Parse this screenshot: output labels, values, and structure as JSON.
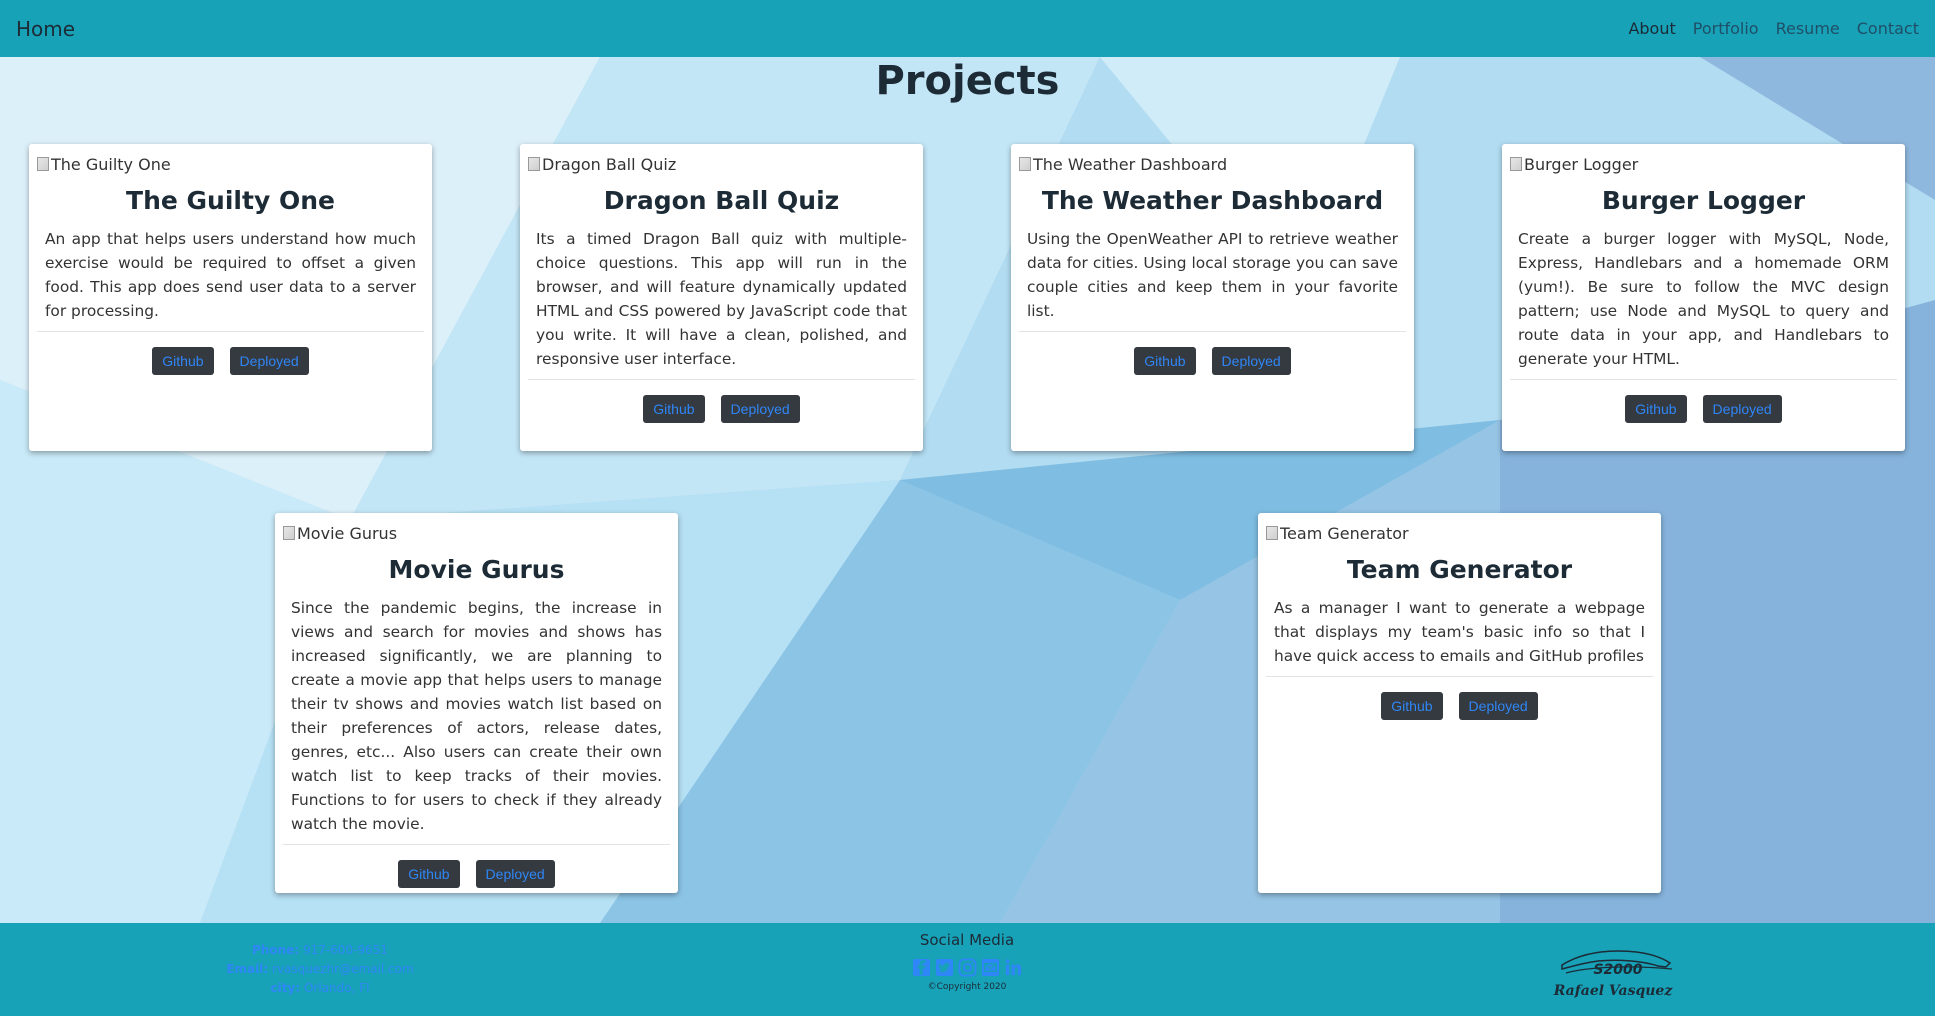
{
  "nav": {
    "brand": "Home",
    "links": [
      "About",
      "Portfolio",
      "Resume",
      "Contact"
    ]
  },
  "page": {
    "title": "Projects"
  },
  "projects": [
    {
      "img_alt": "The Guilty One",
      "title": "The Guilty One",
      "description": "An app that helps users understand how much exercise would be required to offset a given food. This app does send user data to a server for processing.",
      "github_label": "Github",
      "deployed_label": "Deployed"
    },
    {
      "img_alt": "Dragon Ball Quiz",
      "title": "Dragon Ball Quiz",
      "description": "Its a timed Dragon Ball quiz with multiple-choice questions. This app will run in the browser, and will feature dynamically updated HTML and CSS powered by JavaScript code that you write. It will have a clean, polished, and responsive user interface.",
      "github_label": "Github",
      "deployed_label": "Deployed"
    },
    {
      "img_alt": "The Weather Dashboard",
      "title": "The Weather Dashboard",
      "description": "Using the OpenWeather API to retrieve weather data for cities. Using local storage you can save couple cities and keep them in your favorite list.",
      "github_label": "Github",
      "deployed_label": "Deployed"
    },
    {
      "img_alt": "Burger Logger",
      "title": "Burger Logger",
      "description": "Create a burger logger with MySQL, Node, Express, Handlebars and a homemade ORM (yum!). Be sure to follow the MVC design pattern; use Node and MySQL to query and route data in your app, and Handlebars to generate your HTML.",
      "github_label": "Github",
      "deployed_label": "Deployed"
    },
    {
      "img_alt": "Movie Gurus",
      "title": "Movie Gurus",
      "description": "Since the pandemic begins, the increase in views and search for movies and shows has increased significantly, we are planning to create a movie app that helps users to manage their tv shows and movies watch list based on their preferences of actors, release dates, genres, etc... Also users can create their own watch list to keep tracks of their movies. Functions to for users to check if they already watch the movie.",
      "github_label": "Github",
      "deployed_label": "Deployed"
    },
    {
      "img_alt": "Team Generator",
      "title": "Team Generator",
      "description": "As a manager I want to generate a webpage that displays my team's basic info so that I have quick access to emails and GitHub profiles",
      "github_label": "Github",
      "deployed_label": "Deployed"
    }
  ],
  "footer": {
    "phone_label": "Phone:",
    "phone": "917-600-9651",
    "email_label": "Email:",
    "email": "rvasquezhr@email.com",
    "city_label": "city:",
    "city": "Orlando, Fl",
    "social_title": "Social Media",
    "social_icons": [
      "facebook-icon",
      "twitter-icon",
      "instagram-icon",
      "email-icon",
      "linkedin-icon"
    ],
    "copyright": "©Copyright 2020",
    "signature_brand": "S2000",
    "signature_name": "Rafael Vasquez"
  },
  "colors": {
    "navbar": "#17a2b8",
    "button_bg": "#343a40",
    "button_text": "#2f86f6",
    "icon": "#2f86f6"
  }
}
